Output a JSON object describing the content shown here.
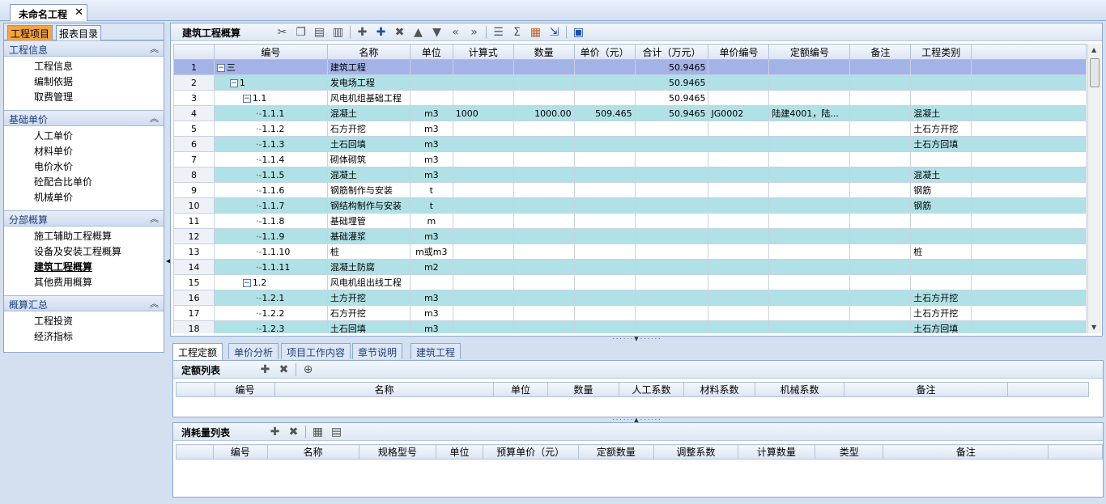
{
  "document_tab": {
    "title": "未命名工程"
  },
  "sidebar": {
    "tabs": [
      "工程项目",
      "报表目录"
    ],
    "sections": [
      {
        "title": "工程信息",
        "items": [
          "工程信息",
          "编制依据",
          "取费管理"
        ]
      },
      {
        "title": "基础单价",
        "items": [
          "人工单价",
          "材料单价",
          "电价水价",
          "砼配合比单价",
          "机械单价"
        ]
      },
      {
        "title": "分部概算",
        "items": [
          "施工辅助工程概算",
          "设备及安装工程概算",
          "建筑工程概算",
          "其他费用概算"
        ]
      },
      {
        "title": "概算汇总",
        "items": [
          "工程投资",
          "经济指标"
        ]
      }
    ]
  },
  "main": {
    "title": "建筑工程概算",
    "columns": [
      "编号",
      "名称",
      "单位",
      "计算式",
      "数量",
      "单价（元）",
      "合计（万元）",
      "单价编号",
      "定额编号",
      "备注",
      "工程类别"
    ],
    "rows": [
      {
        "n": "1",
        "code": "三",
        "name": "建筑工程",
        "unit": "",
        "formula": "",
        "qty": "",
        "price": "",
        "total": "50.9465",
        "pcode": "",
        "quota": "",
        "note": "",
        "cat": ""
      },
      {
        "n": "2",
        "code": "1",
        "name": "发电场工程",
        "unit": "",
        "formula": "",
        "qty": "",
        "price": "",
        "total": "50.9465",
        "pcode": "",
        "quota": "",
        "note": "",
        "cat": ""
      },
      {
        "n": "3",
        "code": "1.1",
        "name": "风电机组基础工程",
        "unit": "",
        "formula": "",
        "qty": "",
        "price": "",
        "total": "50.9465",
        "pcode": "",
        "quota": "",
        "note": "",
        "cat": ""
      },
      {
        "n": "4",
        "code": "1.1.1",
        "name": "混凝土",
        "unit": "m3",
        "formula": "1000",
        "qty": "1000.00",
        "price": "509.465",
        "total": "50.9465",
        "pcode": "JG0002",
        "quota": "陆建4001，陆...",
        "note": "",
        "cat": "混凝土"
      },
      {
        "n": "5",
        "code": "1.1.2",
        "name": "石方开挖",
        "unit": "m3",
        "formula": "",
        "qty": "",
        "price": "",
        "total": "",
        "pcode": "",
        "quota": "",
        "note": "",
        "cat": "土石方开挖"
      },
      {
        "n": "6",
        "code": "1.1.3",
        "name": "土石回填",
        "unit": "m3",
        "formula": "",
        "qty": "",
        "price": "",
        "total": "",
        "pcode": "",
        "quota": "",
        "note": "",
        "cat": "土石方回填"
      },
      {
        "n": "7",
        "code": "1.1.4",
        "name": "砌体砌筑",
        "unit": "m3",
        "formula": "",
        "qty": "",
        "price": "",
        "total": "",
        "pcode": "",
        "quota": "",
        "note": "",
        "cat": ""
      },
      {
        "n": "8",
        "code": "1.1.5",
        "name": "混凝土",
        "unit": "m3",
        "formula": "",
        "qty": "",
        "price": "",
        "total": "",
        "pcode": "",
        "quota": "",
        "note": "",
        "cat": "混凝土"
      },
      {
        "n": "9",
        "code": "1.1.6",
        "name": "钢筋制作与安装",
        "unit": "t",
        "formula": "",
        "qty": "",
        "price": "",
        "total": "",
        "pcode": "",
        "quota": "",
        "note": "",
        "cat": "钢筋"
      },
      {
        "n": "10",
        "code": "1.1.7",
        "name": "钢结构制作与安装",
        "unit": "t",
        "formula": "",
        "qty": "",
        "price": "",
        "total": "",
        "pcode": "",
        "quota": "",
        "note": "",
        "cat": "钢筋"
      },
      {
        "n": "11",
        "code": "1.1.8",
        "name": "基础埋管",
        "unit": "m",
        "formula": "",
        "qty": "",
        "price": "",
        "total": "",
        "pcode": "",
        "quota": "",
        "note": "",
        "cat": ""
      },
      {
        "n": "12",
        "code": "1.1.9",
        "name": "基础灌浆",
        "unit": "m3",
        "formula": "",
        "qty": "",
        "price": "",
        "total": "",
        "pcode": "",
        "quota": "",
        "note": "",
        "cat": ""
      },
      {
        "n": "13",
        "code": "1.1.10",
        "name": "桩",
        "unit": "m或m3",
        "formula": "",
        "qty": "",
        "price": "",
        "total": "",
        "pcode": "",
        "quota": "",
        "note": "",
        "cat": "桩"
      },
      {
        "n": "14",
        "code": "1.1.11",
        "name": "混凝土防腐",
        "unit": "m2",
        "formula": "",
        "qty": "",
        "price": "",
        "total": "",
        "pcode": "",
        "quota": "",
        "note": "",
        "cat": ""
      },
      {
        "n": "15",
        "code": "1.2",
        "name": "风电机组出线工程",
        "unit": "",
        "formula": "",
        "qty": "",
        "price": "",
        "total": "",
        "pcode": "",
        "quota": "",
        "note": "",
        "cat": ""
      },
      {
        "n": "16",
        "code": "1.2.1",
        "name": "土方开挖",
        "unit": "m3",
        "formula": "",
        "qty": "",
        "price": "",
        "total": "",
        "pcode": "",
        "quota": "",
        "note": "",
        "cat": "土石方开挖"
      },
      {
        "n": "17",
        "code": "1.2.2",
        "name": "石方开挖",
        "unit": "m3",
        "formula": "",
        "qty": "",
        "price": "",
        "total": "",
        "pcode": "",
        "quota": "",
        "note": "",
        "cat": "土石方开挖"
      },
      {
        "n": "18",
        "code": "1.2.3",
        "name": "土石回填",
        "unit": "m3",
        "formula": "",
        "qty": "",
        "price": "",
        "total": "",
        "pcode": "",
        "quota": "",
        "note": "",
        "cat": "土石方回填"
      }
    ]
  },
  "bottom_tabs": [
    "工程定额",
    "单价分析",
    "项目工作内容",
    "章节说明",
    "建筑工程"
  ],
  "quota_list": {
    "title": "定额列表",
    "columns": [
      "编号",
      "名称",
      "单位",
      "数量",
      "人工系数",
      "材料系数",
      "机械系数",
      "备注"
    ]
  },
  "consumption_list": {
    "title": "消耗量列表",
    "columns": [
      "编号",
      "名称",
      "规格型号",
      "单位",
      "预算单价（元）",
      "定额数量",
      "调整系数",
      "计算数量",
      "类型",
      "备注"
    ]
  }
}
